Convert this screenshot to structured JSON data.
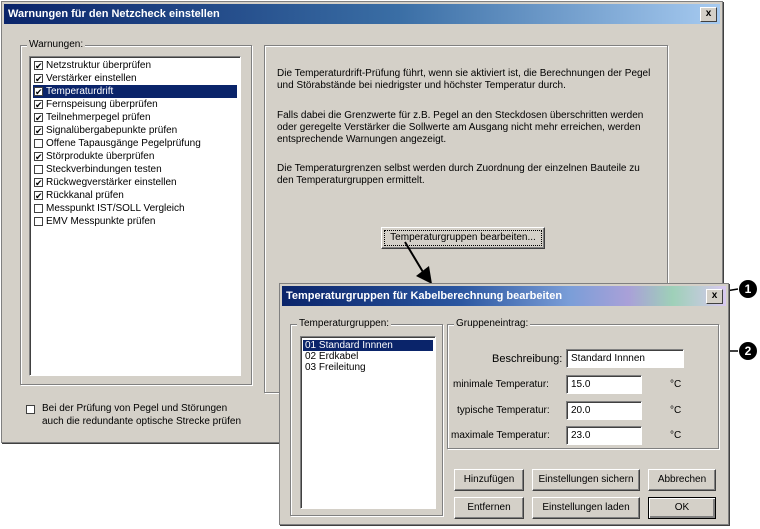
{
  "main_dialog": {
    "title": "Warnungen für den Netzcheck einstellen",
    "close_symbol": "x",
    "warnings_label": "Warnungen:",
    "warnings": [
      {
        "label": "Netzstruktur überprüfen",
        "checked": true
      },
      {
        "label": "Verstärker einstellen",
        "checked": true
      },
      {
        "label": "Temperaturdrift",
        "checked": true,
        "selected": true
      },
      {
        "label": "Fernspeisung überprüfen",
        "checked": true
      },
      {
        "label": "Teilnehmerpegel prüfen",
        "checked": true
      },
      {
        "label": "Signalübergabepunkte prüfen",
        "checked": true
      },
      {
        "label": "Offene Tapausgänge Pegelprüfung",
        "checked": false
      },
      {
        "label": "Störprodukte überprüfen",
        "checked": true
      },
      {
        "label": "Steckverbindungen testen",
        "checked": false
      },
      {
        "label": "Rückwegverstärker einstellen",
        "checked": true
      },
      {
        "label": "Rückkanal prüfen",
        "checked": true
      },
      {
        "label": "Messpunkt IST/SOLL Vergleich",
        "checked": false
      },
      {
        "label": "EMV Messpunkte prüfen",
        "checked": false
      }
    ],
    "description_paragraphs": [
      "Die Temperaturdrift-Prüfung führt, wenn sie aktiviert ist, die Berechnungen der Pegel und Störabstände bei niedrigster und höchster Temperatur durch.",
      "Falls dabei die Grenzwerte für z.B. Pegel an den Steckdosen überschritten werden oder geregelte Verstärker die Sollwerte am Ausgang nicht mehr erreichen, werden entsprechende Warnungen angezeigt.",
      "Die Temperaturgrenzen selbst werden durch Zuordnung der einzelnen Bauteile zu den Temperaturgruppen ermittelt."
    ],
    "edit_groups_button": "Temperaturgruppen bearbeiten...",
    "redundant_option": {
      "checked": false,
      "line1": "Bei der Prüfung von Pegel und Störungen",
      "line2": "auch die redundante optische Strecke prüfen"
    }
  },
  "group_dialog": {
    "title": "Temperaturgruppen für Kabelberechnung bearbeiten",
    "close_symbol": "x",
    "groups_label": "Temperaturgruppen:",
    "groups": [
      {
        "label": "01 Standard Innnen",
        "selected": true
      },
      {
        "label": "02 Erdkabel",
        "selected": false
      },
      {
        "label": "03 Freileitung",
        "selected": false
      }
    ],
    "entry_label": "Gruppeneintrag:",
    "description_label": "Beschreibung:",
    "description_value": "Standard Innnen",
    "min_label": "minimale Temperatur:",
    "min_value": "15.0",
    "typ_label": "typische Temperatur:",
    "typ_value": "20.0",
    "max_label": "maximale Temperatur:",
    "max_value": "23.0",
    "unit": "°C",
    "buttons": {
      "add": "Hinzufügen",
      "save_settings": "Einstellungen sichern",
      "cancel": "Abbrechen",
      "remove": "Entfernen",
      "load_settings": "Einstellungen laden",
      "ok": "OK"
    }
  },
  "callouts": [
    "1",
    "2"
  ]
}
